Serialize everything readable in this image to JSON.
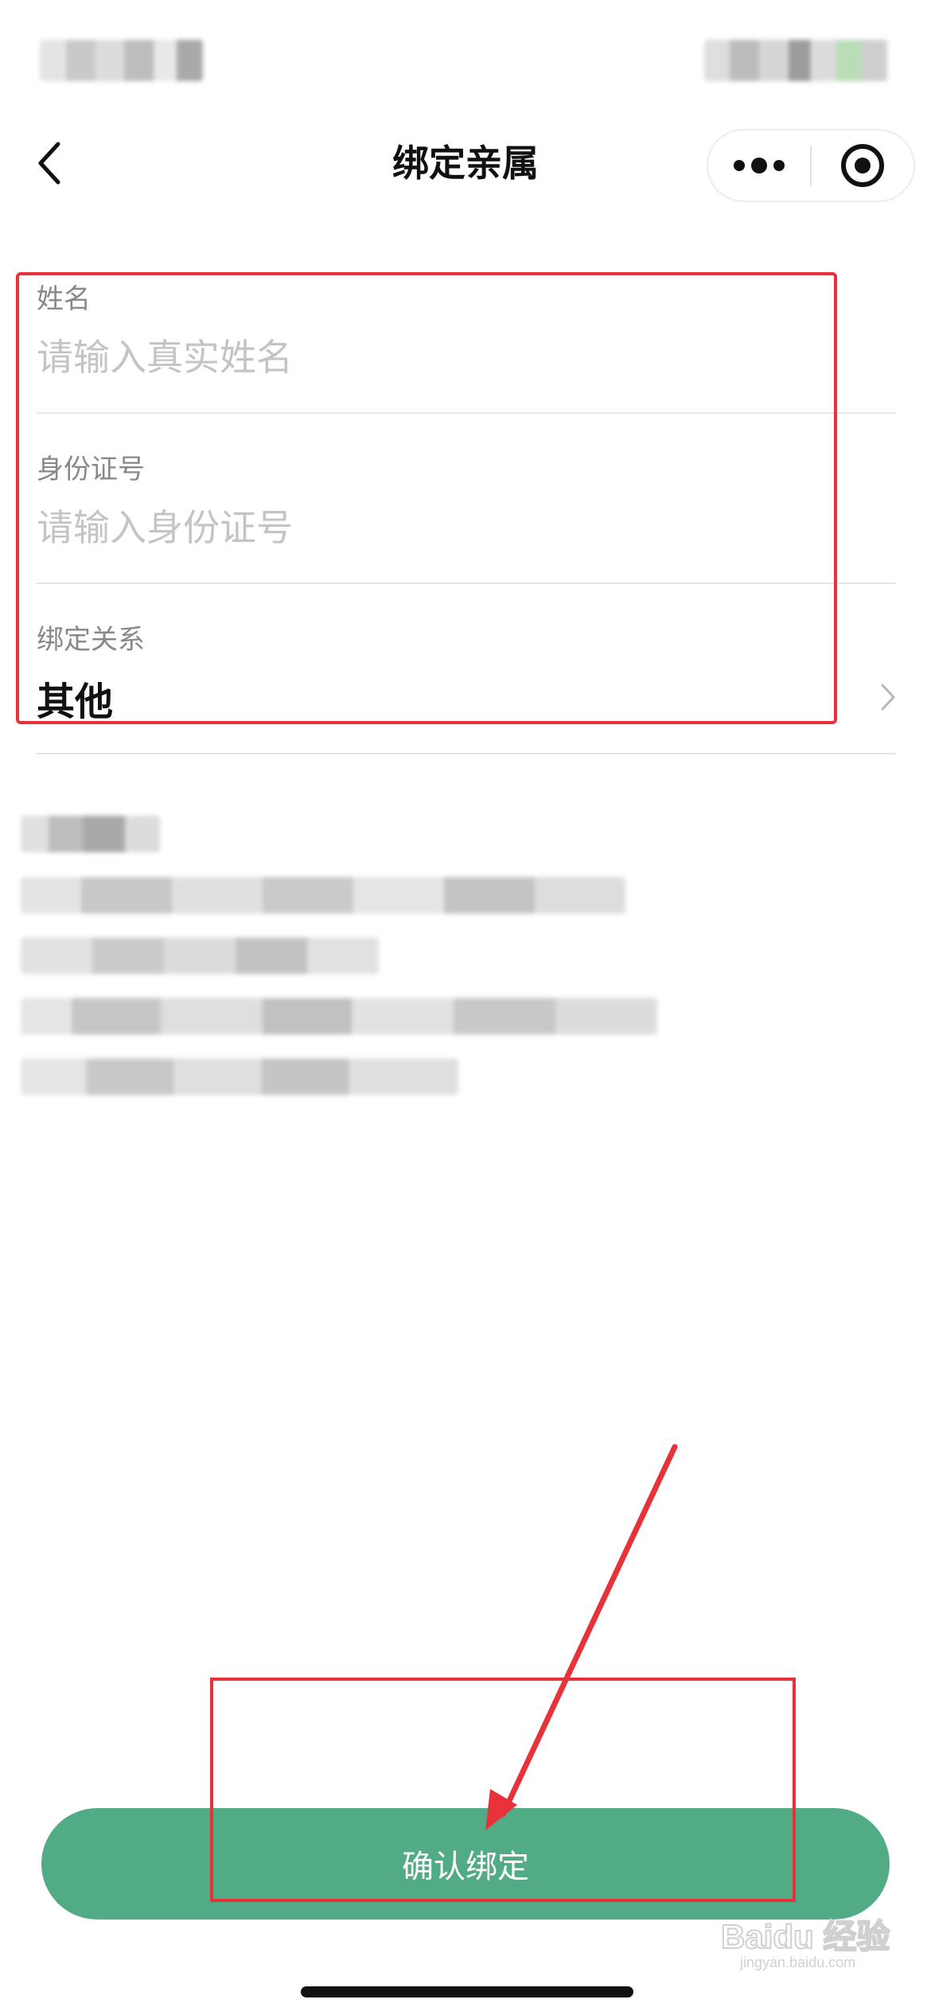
{
  "nav": {
    "title": "绑定亲属",
    "back_icon": "chevron-left-icon",
    "more_icon": "more-dots-icon",
    "close_icon": "target-circle-icon"
  },
  "form": {
    "name": {
      "label": "姓名",
      "placeholder": "请输入真实姓名",
      "value": ""
    },
    "id_number": {
      "label": "身份证号",
      "placeholder": "请输入身份证号",
      "value": ""
    },
    "relation": {
      "label": "绑定关系",
      "value": "其他",
      "icon": "chevron-right-icon"
    }
  },
  "actions": {
    "confirm_label": "确认绑定"
  },
  "watermark": {
    "text": "Baidu 经验",
    "sub": "jingyan.baidu.com"
  },
  "colors": {
    "primary": "#51ab84",
    "annotation": "#e8323a"
  }
}
